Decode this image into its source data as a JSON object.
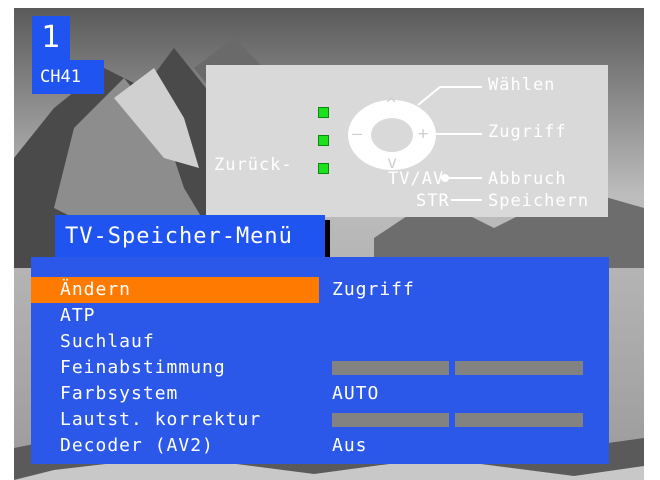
{
  "channel": {
    "number": "1",
    "name": "CH41"
  },
  "help": {
    "select": "Wählen",
    "access": "Zugriff",
    "back": "Zurück-",
    "tvav": "TV/AV",
    "cancel": "Abbruch",
    "str": "STR",
    "save": "Speichern",
    "dpad": {
      "up": "^",
      "down": "v",
      "left": "—",
      "right": "+"
    }
  },
  "menu": {
    "title": "TV-Speicher-Menü",
    "items": [
      {
        "label": "Ändern",
        "value": "Zugriff",
        "selected": true
      },
      {
        "label": "ATP",
        "value": ""
      },
      {
        "label": "Suchlauf",
        "value": ""
      },
      {
        "label": "Feinabstimmung",
        "value": ""
      },
      {
        "label": "Farbsystem",
        "value": "AUTO"
      },
      {
        "label": "Lautst. korrektur",
        "value": ""
      },
      {
        "label": "Decoder (AV2)",
        "value": "Aus"
      }
    ]
  },
  "colors": {
    "osd_blue": "#1f54f0",
    "highlight_orange": "#ff7a00",
    "help_panel": "#d9d9d9",
    "indicator_green": "#1ee01e",
    "bar_gray": "#828282"
  }
}
